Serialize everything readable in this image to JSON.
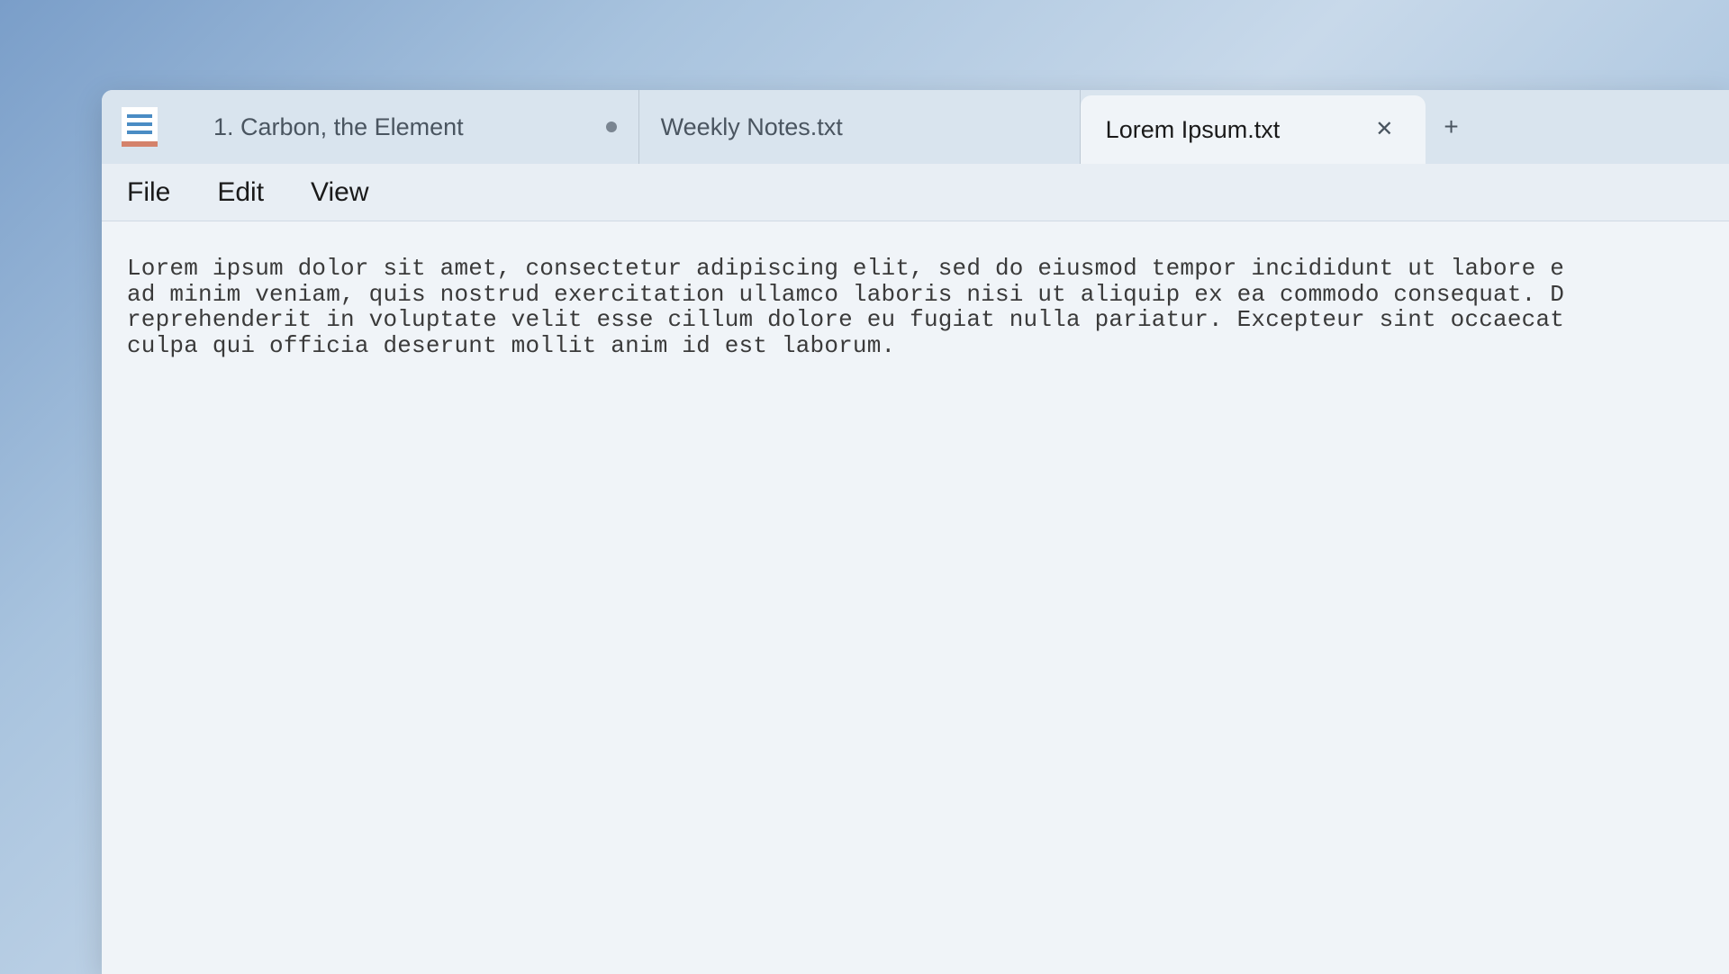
{
  "app": {
    "icon_name": "notepad-icon"
  },
  "tabs": [
    {
      "label": "1. Carbon, the Element",
      "active": false,
      "unsaved": true
    },
    {
      "label": "Weekly Notes.txt",
      "active": false,
      "unsaved": false
    },
    {
      "label": "Lorem Ipsum.txt",
      "active": true,
      "unsaved": false
    }
  ],
  "menubar": {
    "file": "File",
    "edit": "Edit",
    "view": "View"
  },
  "editor": {
    "content": "Lorem ipsum dolor sit amet, consectetur adipiscing elit, sed do eiusmod tempor incididunt ut labore e\nad minim veniam, quis nostrud exercitation ullamco laboris nisi ut aliquip ex ea commodo consequat. D\nreprehenderit in voluptate velit esse cillum dolore eu fugiat nulla pariatur. Excepteur sint occaecat\nculpa qui officia deserunt mollit anim id est laborum."
  },
  "icons": {
    "close": "✕",
    "new_tab": "+"
  }
}
